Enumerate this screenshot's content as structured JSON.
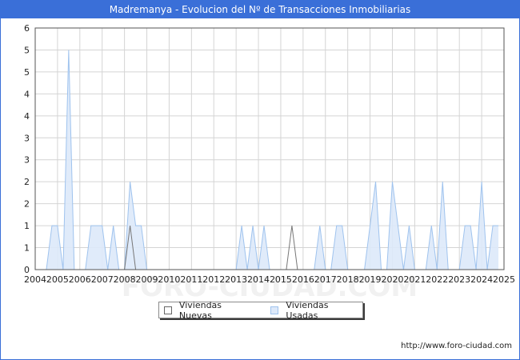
{
  "title": "Madremanya - Evolucion del Nº de Transacciones Inmobiliarias",
  "footer_url": "http://www.foro-ciudad.com",
  "watermark": "FORO-CIUDAD.COM",
  "colors": {
    "title_bg": "#3a6fd8",
    "nuevas_fill": "#ffffff",
    "nuevas_line": "#777777",
    "usadas_fill": "#dde9fa",
    "usadas_line": "#9fc3ee",
    "grid": "#d4d4d4"
  },
  "chart_data": {
    "type": "area",
    "title": "Madremanya - Evolucion del Nº de Transacciones Inmobiliarias",
    "xlabel": "",
    "ylabel": "",
    "x_ticks": [
      "2004",
      "2005",
      "2006",
      "2007",
      "2008",
      "2009",
      "2010",
      "2011",
      "2012",
      "2013",
      "2014",
      "2015",
      "2016",
      "2017",
      "2018",
      "2019",
      "2020",
      "2021",
      "2022",
      "2023",
      "2024",
      "2025"
    ],
    "y_ticks": [
      "0",
      "1",
      "1",
      "2",
      "2",
      "3",
      "3",
      "4",
      "4",
      "5",
      "5",
      "6"
    ],
    "xlim": [
      2004,
      2025
    ],
    "ylim": [
      0,
      5.5
    ],
    "grid": true,
    "legend_position": "bottom-center",
    "series": [
      {
        "name": "Viviendas Nuevas",
        "points": [
          [
            2008.0,
            0
          ],
          [
            2008.25,
            1
          ],
          [
            2008.5,
            0
          ],
          [
            2015.25,
            0
          ],
          [
            2015.5,
            1
          ],
          [
            2015.75,
            0
          ]
        ]
      },
      {
        "name": "Viviendas Usadas",
        "points": [
          [
            2004.5,
            0
          ],
          [
            2004.75,
            1
          ],
          [
            2005.0,
            1
          ],
          [
            2005.25,
            0
          ],
          [
            2005.5,
            5
          ],
          [
            2005.75,
            0
          ],
          [
            2006.25,
            0
          ],
          [
            2006.5,
            1
          ],
          [
            2007.0,
            1
          ],
          [
            2007.25,
            0
          ],
          [
            2007.5,
            1
          ],
          [
            2007.75,
            0
          ],
          [
            2008.0,
            0
          ],
          [
            2008.25,
            2
          ],
          [
            2008.5,
            1
          ],
          [
            2008.75,
            1
          ],
          [
            2009.0,
            0
          ],
          [
            2013.0,
            0
          ],
          [
            2013.25,
            1
          ],
          [
            2013.5,
            0
          ],
          [
            2013.75,
            1
          ],
          [
            2014.0,
            0
          ],
          [
            2014.25,
            1
          ],
          [
            2014.5,
            0
          ],
          [
            2016.5,
            0
          ],
          [
            2016.75,
            1
          ],
          [
            2017.0,
            0
          ],
          [
            2017.25,
            0
          ],
          [
            2017.5,
            1
          ],
          [
            2017.75,
            1
          ],
          [
            2018.0,
            0
          ],
          [
            2018.75,
            0
          ],
          [
            2019.25,
            2
          ],
          [
            2019.5,
            0
          ],
          [
            2019.75,
            0
          ],
          [
            2020.0,
            2
          ],
          [
            2020.5,
            0
          ],
          [
            2020.75,
            1
          ],
          [
            2021.0,
            0
          ],
          [
            2021.5,
            0
          ],
          [
            2021.75,
            1
          ],
          [
            2022.0,
            0
          ],
          [
            2022.25,
            2
          ],
          [
            2022.5,
            0
          ],
          [
            2023.0,
            0
          ],
          [
            2023.25,
            1
          ],
          [
            2023.5,
            1
          ],
          [
            2023.75,
            0
          ],
          [
            2024.0,
            2
          ],
          [
            2024.25,
            0
          ],
          [
            2024.5,
            1
          ],
          [
            2024.75,
            1
          ]
        ]
      }
    ]
  }
}
